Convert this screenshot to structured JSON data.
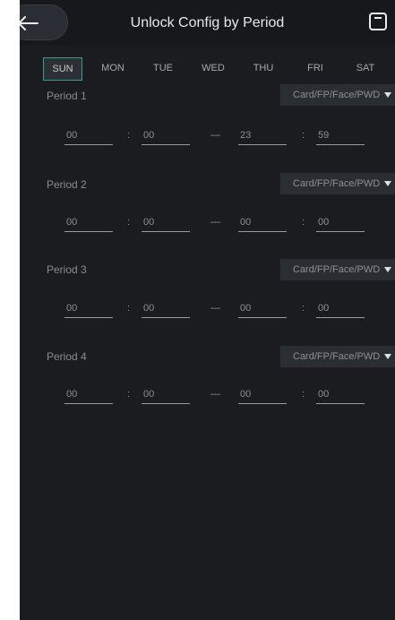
{
  "header": {
    "title": "Unlock Config by Period",
    "back_icon": "arrow-left-icon",
    "save_icon": "save-icon"
  },
  "days": [
    "SUN",
    "MON",
    "TUE",
    "WED",
    "THU",
    "FRI",
    "SAT"
  ],
  "selected_day": "SUN",
  "periods": [
    {
      "label": "Period 1",
      "mode": "Card/FP/Face/PWD",
      "start_hour": "00",
      "start_min": "00",
      "end_hour": "23",
      "end_min": "59"
    },
    {
      "label": "Period 2",
      "mode": "Card/FP/Face/PWD",
      "start_hour": "00",
      "start_min": "00",
      "end_hour": "00",
      "end_min": "00"
    },
    {
      "label": "Period 3",
      "mode": "Card/FP/Face/PWD",
      "start_hour": "00",
      "start_min": "00",
      "end_hour": "00",
      "end_min": "00"
    },
    {
      "label": "Period 4",
      "mode": "Card/FP/Face/PWD",
      "start_hour": "00",
      "start_min": "00",
      "end_hour": "00",
      "end_min": "00"
    }
  ],
  "separators": {
    "colon": ":",
    "dash": "—"
  },
  "colors": {
    "accent": "#3b9b8e",
    "background": "#1a1c20"
  }
}
